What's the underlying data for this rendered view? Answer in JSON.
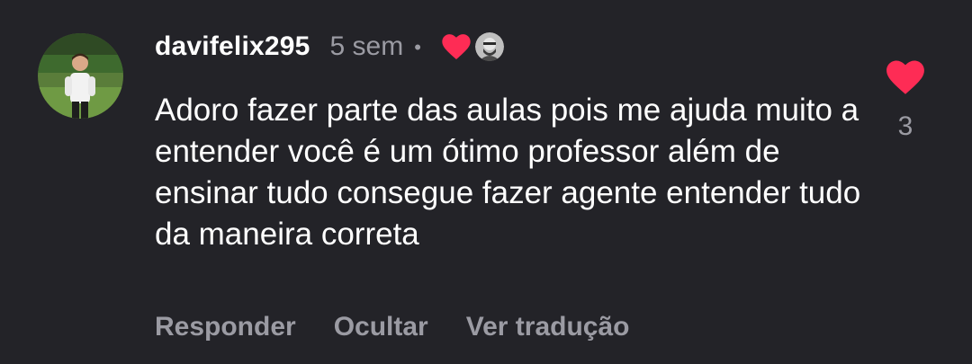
{
  "comment": {
    "username": "davifelix295",
    "time": "5 sem",
    "separator": "•",
    "text": "Adoro fazer parte das aulas pois me ajuda muito a entender você é um ótimo professor além de ensinar tudo consegue fazer agente entender tudo da maneira correta",
    "actions": {
      "reply": "Responder",
      "hide": "Ocultar",
      "translate": "Ver tradução"
    },
    "like_count": "3"
  },
  "icons": {
    "avatar": "user-avatar",
    "creator_heart": "heart-icon",
    "creator_avatar": "creator-avatar",
    "like": "heart-icon"
  },
  "colors": {
    "background": "#232328",
    "heart": "#fe2c55",
    "muted_text": "#9b9ba3",
    "primary_text": "#ffffff"
  }
}
